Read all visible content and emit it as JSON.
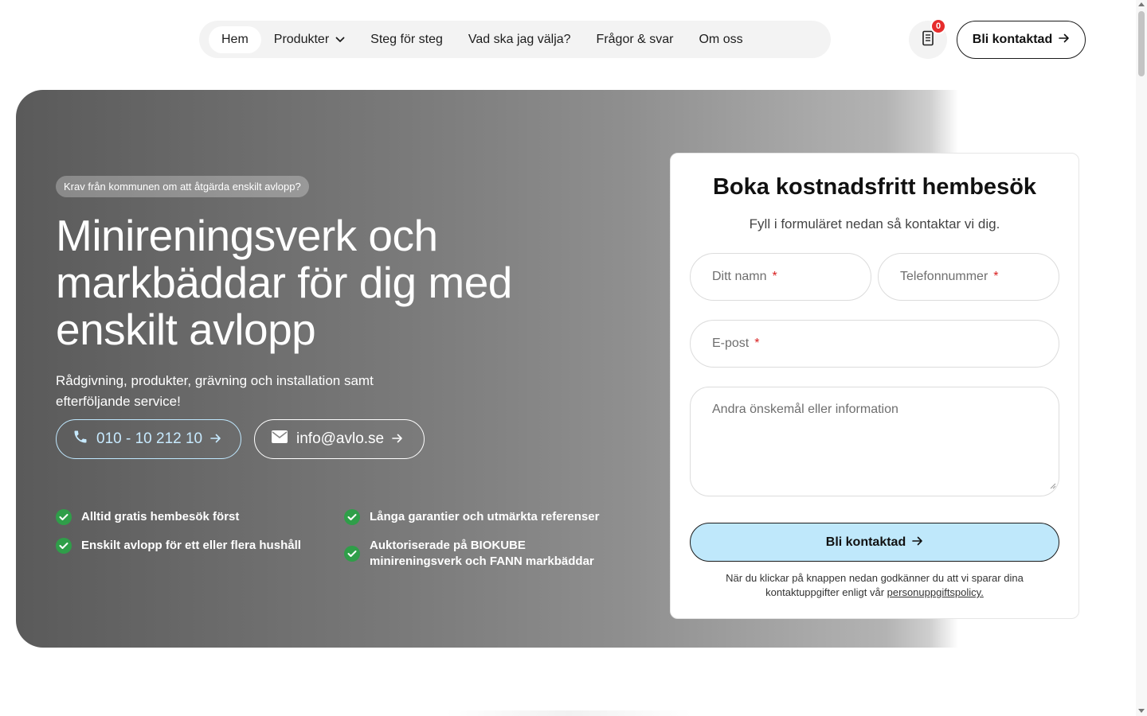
{
  "nav": {
    "items": [
      {
        "label": "Hem",
        "active": true
      },
      {
        "label": "Produkter",
        "has_dropdown": true
      },
      {
        "label": "Steg för steg"
      },
      {
        "label": "Vad ska jag välja?"
      },
      {
        "label": "Frågor & svar"
      },
      {
        "label": "Om oss"
      }
    ],
    "cart_count": "0",
    "contact_button": "Bli kontaktad"
  },
  "hero": {
    "badge": "Krav från kommunen om att åtgärda enskilt avlopp?",
    "title": "Minireningsverk och markbäddar för dig med enskilt avlopp",
    "subtitle": "Rådgivning, produkter, grävning och installation samt efterföljande service!",
    "phone": "010 - 10 212 10",
    "email": "info@avlo.se",
    "features": [
      "Alltid gratis hembesök först",
      "Långa garantier och utmärkta referenser",
      "Enskilt avlopp för ett eller flera hushåll",
      "Auktoriserade på BIOKUBE minireningsverk och FANN markbäddar"
    ]
  },
  "form": {
    "title": "Boka kostnadsfritt hembesök",
    "subtitle": "Fyll i formuläret nedan så kontaktar vi dig.",
    "name_placeholder": "Ditt namn",
    "phone_placeholder": "Telefonnummer",
    "email_placeholder": "E-post",
    "message_placeholder": "Andra önskemål eller information",
    "required_mark": "*",
    "submit": "Bli kontaktad",
    "consent_text": "När du klickar på knappen nedan godkänner du att vi sparar dina kontaktuppgifter enligt vår",
    "consent_link": "personuppgiftspolicy."
  },
  "colors": {
    "accent_light_blue": "#bfe8fb",
    "check_green": "#2f9e49",
    "badge_red": "#e62c2c"
  }
}
